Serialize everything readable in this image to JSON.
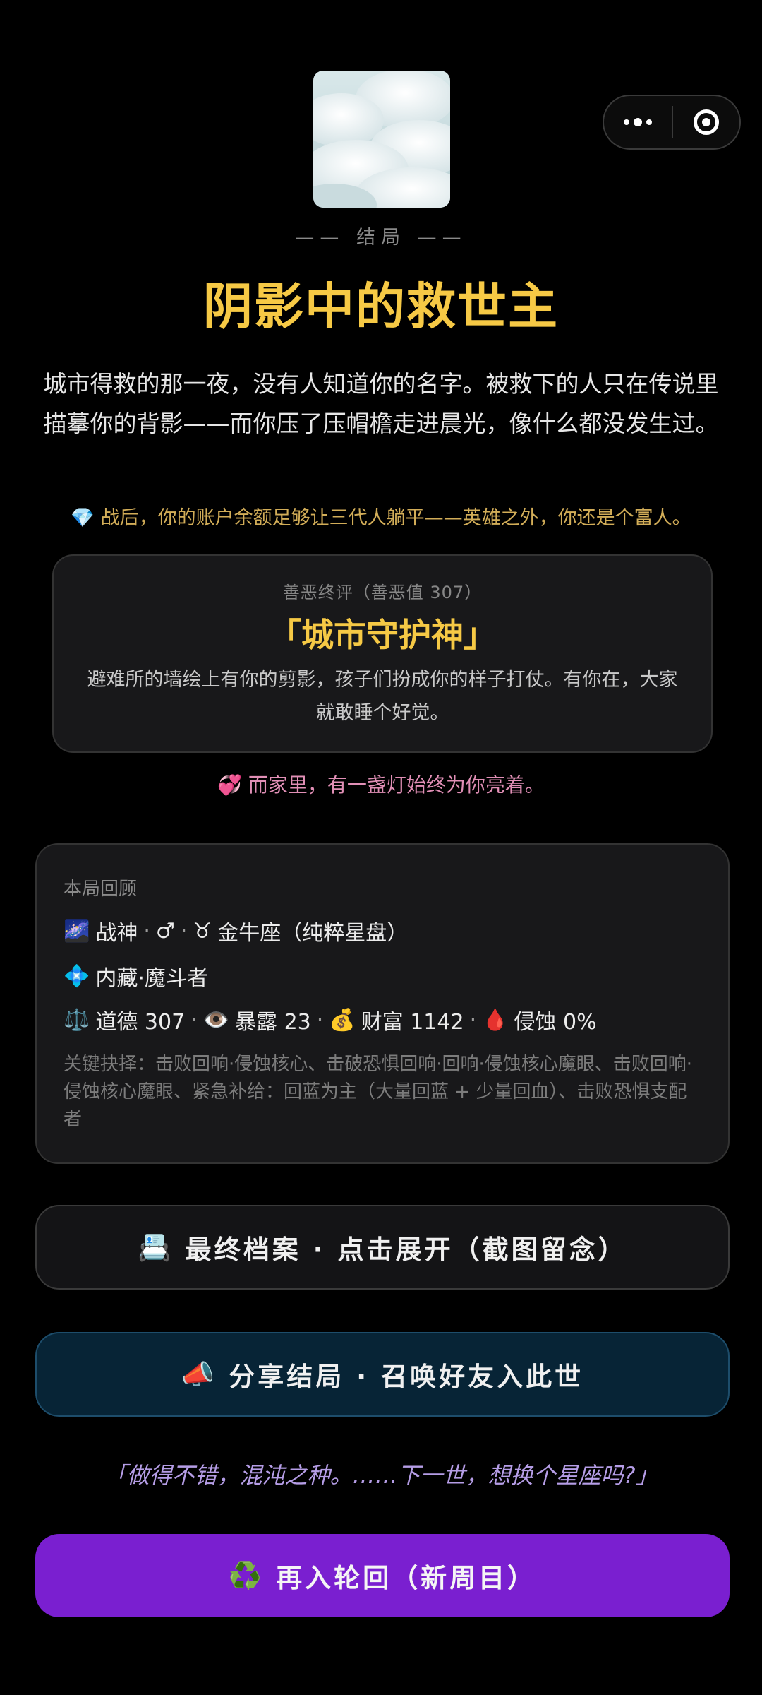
{
  "header": {
    "menu_icon": "more-dots-icon",
    "close_icon": "target-circle-icon"
  },
  "ending": {
    "label": "—— 结局 ——",
    "title": "阴影中的救世主",
    "narrative": "城市得救的那一夜，没有人知道你的名字。被救下的人只在传说里描摹你的背影——而你压了压帽檐走进晨光，像什么都没发生过。",
    "wealth_icon": "💎",
    "wealth_note": "战后，你的账户余额足够让三代人躺平——英雄之外，你还是个富人。"
  },
  "verdict": {
    "caption": "善恶终评（善恶值 307）",
    "title": "「城市守护神」",
    "description": "避难所的墙绘上有你的剪影，孩子们扮成你的样子打仗。有你在，大家就敢睡个好觉。"
  },
  "family": {
    "icon": "💞",
    "text": "而家里，有一盏灯始终为你亮着。"
  },
  "recap": {
    "heading": "本局回顾",
    "line1": {
      "icon1": "🌌",
      "role": "战神",
      "gender": "♂",
      "icon2": "♉",
      "sign": "金牛座（纯粹星盘）"
    },
    "line2": {
      "icon": "💠",
      "text": "内藏·魔斗者"
    },
    "stats": {
      "morality_icon": "⚖️",
      "morality": "道德 307",
      "exposure_icon": "👁️",
      "exposure": "暴露 23",
      "wealth_icon": "💰",
      "wealth": "财富 1142",
      "corrosion_icon": "🩸",
      "corrosion": "侵蚀 0%"
    },
    "choices_label": "关键抉择：",
    "choices": "击败回响·侵蚀核心、击破恐惧回响·回响·侵蚀核心魔眼、击败回响·侵蚀核心魔眼、紧急补给：回蓝为主（大量回蓝 + 少量回血）、击败恐惧支配者"
  },
  "buttons": {
    "archive_icon": "📇",
    "archive": "最终档案 · 点击展开（截图留念）",
    "share_icon": "📣",
    "share": "分享结局 · 召唤好友入此世",
    "rebirth_icon": "♻️",
    "rebirth": "再入轮回（新周目）"
  },
  "quote": "「做得不错，混沌之种。……下一世，想换个星座吗?」",
  "colors": {
    "gold": "#f6c945",
    "wealth_text": "#d2ad58",
    "family_text": "#e18fb6",
    "quote_text": "#b59de6",
    "share_bg": "#072436",
    "rebirth_bg": "#7a1fd0",
    "card_bg": "#18181a"
  }
}
